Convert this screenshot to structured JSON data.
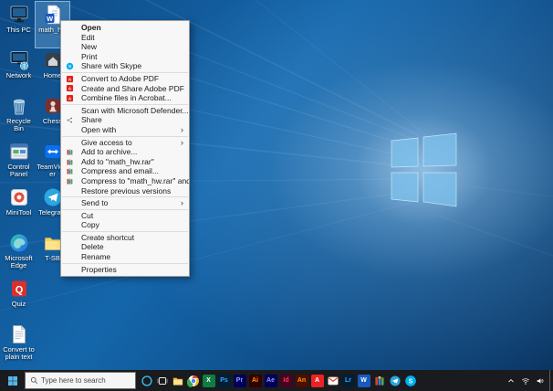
{
  "wallpaper": {
    "base_color": "#1466ab",
    "logo_color": "#7cc0ea"
  },
  "desktop": {
    "columns": [
      {
        "icons": [
          {
            "label": "This PC",
            "icon": "this-pc"
          },
          {
            "label": "Network",
            "icon": "network"
          },
          {
            "label": "Recycle Bin",
            "icon": "recycle-bin"
          },
          {
            "label": "Control Panel",
            "icon": "control-panel"
          },
          {
            "label": "MiniTool",
            "icon": "minitool"
          },
          {
            "label": "Microsoft Edge",
            "icon": "edge"
          },
          {
            "label": "Quiz",
            "icon": "quiz"
          },
          {
            "label": "Convert to plain text",
            "icon": "text-file"
          }
        ]
      },
      {
        "icons": [
          {
            "label": "math_hw",
            "icon": "word-doc",
            "selected": true
          },
          {
            "label": "Home",
            "icon": "home"
          },
          {
            "label": "Chess",
            "icon": "chess"
          },
          {
            "label": "TeamViewer",
            "icon": "teamviewer"
          },
          {
            "label": "Telegram",
            "icon": "telegram"
          },
          {
            "label": "T-SB",
            "icon": "folder"
          }
        ]
      }
    ]
  },
  "context_menu": {
    "items": [
      {
        "label": "Open",
        "bold": true
      },
      {
        "label": "Edit"
      },
      {
        "label": "New"
      },
      {
        "label": "Print"
      },
      {
        "label": "Share with Skype",
        "icon": "skype"
      },
      {
        "sep": true
      },
      {
        "label": "Convert to Adobe PDF",
        "icon": "adobe-pdf"
      },
      {
        "label": "Create and Share Adobe PDF",
        "icon": "adobe-pdf"
      },
      {
        "label": "Combine files in Acrobat...",
        "icon": "adobe-pdf"
      },
      {
        "sep": true
      },
      {
        "label": "Scan with Microsoft Defender..."
      },
      {
        "label": "Share",
        "icon": "share"
      },
      {
        "label": "Open with",
        "submenu": true
      },
      {
        "sep": true
      },
      {
        "label": "Give access to",
        "submenu": true
      },
      {
        "label": "Add to archive...",
        "icon": "winrar"
      },
      {
        "label": "Add to \"math_hw.rar\"",
        "icon": "winrar"
      },
      {
        "label": "Compress and email...",
        "icon": "winrar"
      },
      {
        "label": "Compress to \"math_hw.rar\" and email",
        "icon": "winrar"
      },
      {
        "label": "Restore previous versions"
      },
      {
        "sep": true
      },
      {
        "label": "Send to",
        "submenu": true
      },
      {
        "sep": true
      },
      {
        "label": "Cut"
      },
      {
        "label": "Copy"
      },
      {
        "sep": true
      },
      {
        "label": "Create shortcut"
      },
      {
        "label": "Delete"
      },
      {
        "label": "Rename"
      },
      {
        "sep": true
      },
      {
        "label": "Properties"
      }
    ]
  },
  "taskbar": {
    "search_placeholder": "Type here to search",
    "pins": [
      {
        "name": "cortana"
      },
      {
        "name": "task-view"
      },
      {
        "name": "file-explorer"
      },
      {
        "name": "chrome"
      },
      {
        "name": "excel",
        "text": "X",
        "bg": "#107c41",
        "fg": "#ffffff"
      },
      {
        "name": "photoshop",
        "text": "Ps",
        "bg": "#001e36",
        "fg": "#31a8ff"
      },
      {
        "name": "premiere",
        "text": "Pr",
        "bg": "#00005b",
        "fg": "#9999ff"
      },
      {
        "name": "illustrator",
        "text": "Ai",
        "bg": "#330000",
        "fg": "#ff9a00"
      },
      {
        "name": "after-effects",
        "text": "Ae",
        "bg": "#00005b",
        "fg": "#9999ff"
      },
      {
        "name": "indesign",
        "text": "Id",
        "bg": "#49021f",
        "fg": "#ff3366"
      },
      {
        "name": "animate",
        "text": "An",
        "bg": "#4e0e00",
        "fg": "#ff9a00"
      },
      {
        "name": "acrobat",
        "text": "A",
        "bg": "#ed2224",
        "fg": "#ffffff"
      },
      {
        "name": "gmail"
      },
      {
        "name": "lightroom",
        "text": "Lr",
        "bg": "#001e36",
        "fg": "#31a8ff"
      },
      {
        "name": "word",
        "text": "W",
        "bg": "#185abd",
        "fg": "#ffffff"
      },
      {
        "name": "winrar"
      },
      {
        "name": "telegram-pin"
      },
      {
        "name": "skype"
      }
    ],
    "tray": [
      {
        "name": "hidden-icons",
        "icon": "chevron"
      },
      {
        "name": "network",
        "icon": "wifi"
      },
      {
        "name": "volume",
        "icon": "volume"
      }
    ]
  }
}
